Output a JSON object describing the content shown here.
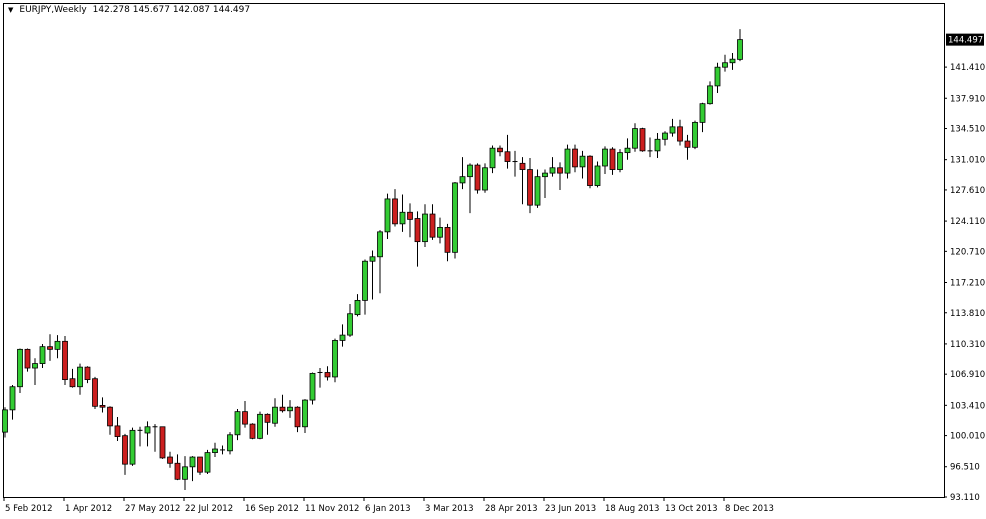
{
  "header": {
    "symbol_timeframe": "EURJPY,Weekly",
    "ohlc_text": "142.278 145.677 142.087 144.497",
    "menu_icon": "triangle-down-icon"
  },
  "colors": {
    "bull": "#33cc33",
    "bear": "#cc1f1f",
    "outline": "#000000",
    "background": "#ffffff",
    "price_tag_bg": "#000000"
  },
  "chart_data": {
    "type": "candlestick",
    "title": "EURJPY,Weekly",
    "xlabel": "",
    "ylabel": "",
    "ylim": [
      93.11,
      148.5
    ],
    "grid": false,
    "current_price": "144.497",
    "y_ticks": [
      "141.410",
      "137.910",
      "134.510",
      "131.010",
      "127.610",
      "124.110",
      "120.710",
      "117.210",
      "113.810",
      "110.310",
      "106.910",
      "103.410",
      "100.010",
      "96.510",
      "93.110"
    ],
    "x_tick_labels": [
      "5 Feb 2012",
      "1 Apr 2012",
      "27 May 2012",
      "22 Jul 2012",
      "16 Sep 2012",
      "11 Nov 2012",
      "6 Jan 2013",
      "3 Mar 2013",
      "28 Apr 2013",
      "23 Jun 2013",
      "18 Aug 2013",
      "13 Oct 2013",
      "8 Dec 2013"
    ],
    "x_tick_every_weeks": 8,
    "ohlc_fields": [
      "open",
      "high",
      "low",
      "close"
    ],
    "candles": [
      [
        100.4,
        103.2,
        99.8,
        102.9
      ],
      [
        102.9,
        105.7,
        101.8,
        105.5
      ],
      [
        105.5,
        109.8,
        104.8,
        109.7
      ],
      [
        109.7,
        109.8,
        107.2,
        107.6
      ],
      [
        107.6,
        108.7,
        105.7,
        108.1
      ],
      [
        108.1,
        110.3,
        107.6,
        110.0
      ],
      [
        110.0,
        111.4,
        108.4,
        109.7
      ],
      [
        109.7,
        111.3,
        108.7,
        110.6
      ],
      [
        110.6,
        111.2,
        105.7,
        106.3
      ],
      [
        106.4,
        107.5,
        105.4,
        105.5
      ],
      [
        105.5,
        108.1,
        104.6,
        107.7
      ],
      [
        107.7,
        107.8,
        105.9,
        106.3
      ],
      [
        106.4,
        106.6,
        103.0,
        103.3
      ],
      [
        103.4,
        104.3,
        102.6,
        103.2
      ],
      [
        103.2,
        103.3,
        100.1,
        101.1
      ],
      [
        101.1,
        102.1,
        99.4,
        99.9
      ],
      [
        100.0,
        100.2,
        95.6,
        96.8
      ],
      [
        96.8,
        100.9,
        96.6,
        100.6
      ],
      [
        100.6,
        101.0,
        98.8,
        100.5
      ],
      [
        100.3,
        101.6,
        98.8,
        101.0
      ],
      [
        101.0,
        101.3,
        98.2,
        101.0
      ],
      [
        101.0,
        101.0,
        97.4,
        97.5
      ],
      [
        97.6,
        98.2,
        96.4,
        96.9
      ],
      [
        96.9,
        97.9,
        95.0,
        95.1
      ],
      [
        95.1,
        97.7,
        93.9,
        96.5
      ],
      [
        96.5,
        97.7,
        94.9,
        97.6
      ],
      [
        97.6,
        97.6,
        95.6,
        95.9
      ],
      [
        95.9,
        98.4,
        95.7,
        98.1
      ],
      [
        98.1,
        99.2,
        97.6,
        98.5
      ],
      [
        98.4,
        98.9,
        97.9,
        98.4
      ],
      [
        98.3,
        100.4,
        97.9,
        100.1
      ],
      [
        100.1,
        103.0,
        99.5,
        102.7
      ],
      [
        102.7,
        103.9,
        100.9,
        101.3
      ],
      [
        101.3,
        101.4,
        99.6,
        99.7
      ],
      [
        99.7,
        102.7,
        99.6,
        102.4
      ],
      [
        102.4,
        102.5,
        100.1,
        101.5
      ],
      [
        101.4,
        104.2,
        101.0,
        103.2
      ],
      [
        103.2,
        104.6,
        102.6,
        102.8
      ],
      [
        102.8,
        104.0,
        102.0,
        103.2
      ],
      [
        103.2,
        103.3,
        100.4,
        101.0
      ],
      [
        101.0,
        104.1,
        100.3,
        104.0
      ],
      [
        104.0,
        107.1,
        103.5,
        107.0
      ],
      [
        107.0,
        107.6,
        105.4,
        107.1
      ],
      [
        107.1,
        107.8,
        106.2,
        106.6
      ],
      [
        106.6,
        110.9,
        106.0,
        110.7
      ],
      [
        110.7,
        112.5,
        110.0,
        111.3
      ],
      [
        111.3,
        114.8,
        111.1,
        113.7
      ],
      [
        113.6,
        115.9,
        113.4,
        115.2
      ],
      [
        115.2,
        119.8,
        113.6,
        119.6
      ],
      [
        119.6,
        120.8,
        115.3,
        120.1
      ],
      [
        120.1,
        123.1,
        116.0,
        122.9
      ],
      [
        122.9,
        127.2,
        122.1,
        126.6
      ],
      [
        126.6,
        127.7,
        123.5,
        123.8
      ],
      [
        123.8,
        127.1,
        122.9,
        125.1
      ],
      [
        125.1,
        126.1,
        122.3,
        124.3
      ],
      [
        124.4,
        125.2,
        119.0,
        121.8
      ],
      [
        121.8,
        126.0,
        121.2,
        124.9
      ],
      [
        124.9,
        126.0,
        122.0,
        122.3
      ],
      [
        122.3,
        124.5,
        121.6,
        123.4
      ],
      [
        123.4,
        123.8,
        119.6,
        120.6
      ],
      [
        120.6,
        128.5,
        119.9,
        128.4
      ],
      [
        128.4,
        131.3,
        127.7,
        129.1
      ],
      [
        129.1,
        130.6,
        125.0,
        130.4
      ],
      [
        130.4,
        130.6,
        127.2,
        127.6
      ],
      [
        127.6,
        130.6,
        127.3,
        130.1
      ],
      [
        130.1,
        132.6,
        129.5,
        132.3
      ],
      [
        132.3,
        132.6,
        131.4,
        131.9
      ],
      [
        131.9,
        133.8,
        130.0,
        130.8
      ],
      [
        130.8,
        132.0,
        129.1,
        130.7
      ],
      [
        130.6,
        131.3,
        126.0,
        129.9
      ],
      [
        129.9,
        131.2,
        125.0,
        125.9
      ],
      [
        125.9,
        129.9,
        125.6,
        129.1
      ],
      [
        129.1,
        129.9,
        126.7,
        129.5
      ],
      [
        129.5,
        131.3,
        129.1,
        130.1
      ],
      [
        130.1,
        130.7,
        127.6,
        129.5
      ],
      [
        129.5,
        132.7,
        128.9,
        132.2
      ],
      [
        132.2,
        132.7,
        129.6,
        130.2
      ],
      [
        130.2,
        132.0,
        128.9,
        131.4
      ],
      [
        131.4,
        131.5,
        127.8,
        128.1
      ],
      [
        128.1,
        130.8,
        127.9,
        130.3
      ],
      [
        130.3,
        132.5,
        129.4,
        132.2
      ],
      [
        132.2,
        132.4,
        129.3,
        129.9
      ],
      [
        129.9,
        132.2,
        129.6,
        131.8
      ],
      [
        131.8,
        133.4,
        131.0,
        132.3
      ],
      [
        132.3,
        135.1,
        131.9,
        134.5
      ],
      [
        134.5,
        134.6,
        131.9,
        132.0
      ],
      [
        132.0,
        133.5,
        131.3,
        132.0
      ],
      [
        132.0,
        134.0,
        131.2,
        133.3
      ],
      [
        133.3,
        134.2,
        132.6,
        134.0
      ],
      [
        134.0,
        135.6,
        133.6,
        134.7
      ],
      [
        134.7,
        135.5,
        132.6,
        133.1
      ],
      [
        133.1,
        133.8,
        131.0,
        132.4
      ],
      [
        132.4,
        135.4,
        132.2,
        135.2
      ],
      [
        135.2,
        137.4,
        134.1,
        137.3
      ],
      [
        137.3,
        139.8,
        137.2,
        139.3
      ],
      [
        139.3,
        141.9,
        138.5,
        141.4
      ],
      [
        141.4,
        142.8,
        140.9,
        141.9
      ],
      [
        141.9,
        143.0,
        141.1,
        142.3
      ],
      [
        142.278,
        145.677,
        142.087,
        144.497
      ]
    ]
  }
}
